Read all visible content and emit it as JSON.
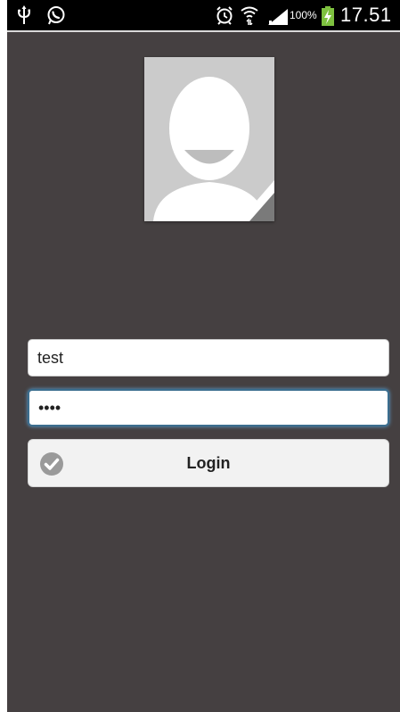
{
  "status_bar": {
    "battery_percent": "100%",
    "time": "17.51",
    "icons": [
      "usb-icon",
      "whatsapp-icon",
      "alarm-icon",
      "wifi-icon",
      "signal-icon",
      "battery-charging-icon"
    ]
  },
  "avatar": {
    "icon": "default-user-avatar"
  },
  "login_form": {
    "username_value": "test",
    "password_value": "••••",
    "login_label": "Login",
    "login_icon": "check-circle-icon"
  },
  "colors": {
    "background": "#454041",
    "status_bar": "#000000",
    "focus_border": "#3b6e8f"
  }
}
